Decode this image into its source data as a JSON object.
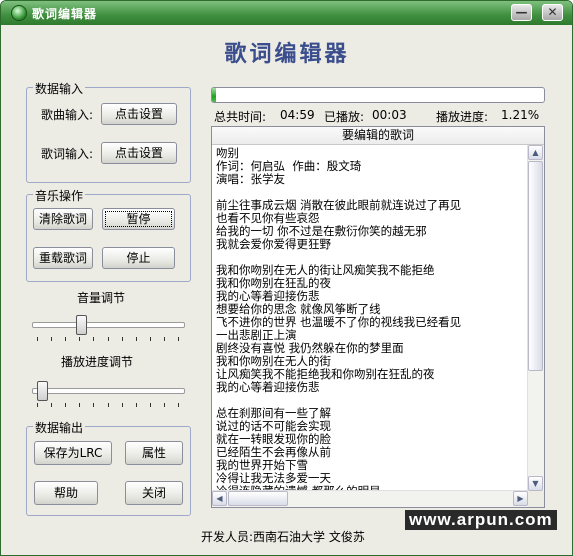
{
  "window": {
    "title": "歌词编辑器",
    "minimize_glyph": "—",
    "close_glyph": "✕"
  },
  "heading": "歌词编辑器",
  "data_input": {
    "title": "数据输入",
    "song_label": "歌曲输入:",
    "song_button": "点击设置",
    "lyrics_label": "歌词输入:",
    "lyrics_button": "点击设置"
  },
  "music_ops": {
    "title": "音乐操作",
    "clear_button": "清除歌词",
    "pause_button": "暂停",
    "reload_button": "重载歌词",
    "stop_button": "停止"
  },
  "volume": {
    "label": "音量调节",
    "value": 0.3
  },
  "seek": {
    "label": "播放进度调节",
    "value": 0.0
  },
  "data_output": {
    "title": "数据输出",
    "save_lrc_button": "保存为LRC",
    "properties_button": "属性",
    "help_button": "帮助",
    "close_button": "关闭"
  },
  "playback": {
    "total_label": "总共时间:",
    "total_value": "04:59",
    "played_label": "已播放:",
    "played_value": "00:03",
    "progress_label": "播放进度:",
    "progress_value": "1.21%",
    "progress_fraction": 0.0121
  },
  "lyrics": {
    "header": "要编辑的歌词",
    "lines": [
      "吻别",
      "作词：何启弘  作曲：殷文琦",
      "演唱：张学友",
      "",
      "前尘往事成云烟 消散在彼此眼前就连说过了再见",
      "也看不见你有些哀怨",
      "给我的一切 你不过是在敷衍你笑的越无邪",
      "我就会爱你爱得更狂野",
      "",
      "我和你吻别在无人的街让风痴笑我不能拒绝",
      "我和你吻别在狂乱的夜",
      "我的心等着迎接伤悲",
      "想要给你的思念 就像风筝断了线",
      "飞不进你的世界 也温暖不了你的视线我已经看见",
      "一出悲剧正上演",
      "剧终没有喜悦 我仍然躲在你的梦里面",
      "我和你吻别在无人的街",
      "让风痴笑我不能拒绝我和你吻别在狂乱的夜",
      "我的心等着迎接伤悲",
      "",
      "总在刹那间有一些了解",
      "说过的话不可能会实现",
      "就在一转眼发现你的脸",
      "已经陌生不会再像从前",
      "我的世界开始下雪",
      "冷得让我无法多爱一天",
      "冷得连隐藏的遗憾 都那么的明显"
    ]
  },
  "scroll_arrows": {
    "up": "▲",
    "down": "▼",
    "left": "◀",
    "right": "▶"
  },
  "footer": "开发人员:西南石油大学  文俊苏",
  "watermark": "www.arpun.com",
  "colors": {
    "title_bar": "#3f8f3f",
    "heading": "#3a4d8c",
    "progress": "#22a022"
  }
}
